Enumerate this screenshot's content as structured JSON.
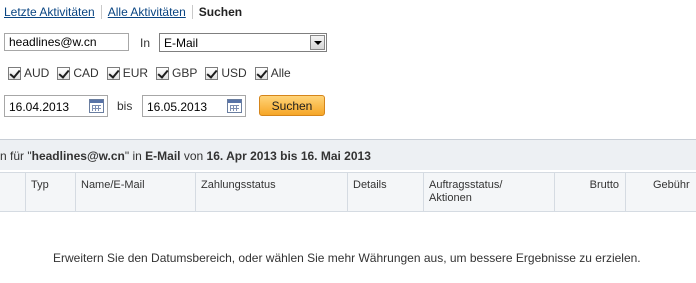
{
  "tabs": {
    "recent_activity": "Letzte Aktivitäten",
    "all_activity": "Alle Aktivitäten",
    "search": "Suchen"
  },
  "search": {
    "query_value": "headlines@w.cn",
    "in_label": "In",
    "field_selected": "E-Mail"
  },
  "currencies": [
    "AUD",
    "CAD",
    "EUR",
    "GBP",
    "USD",
    "Alle"
  ],
  "dates": {
    "from": "16.04.2013",
    "to_label": "bis",
    "to": "16.05.2013"
  },
  "submit_label": "Suchen",
  "results_header": {
    "prefix": "n für \"",
    "query": "headlines@w.cn",
    "mid1": "\" in ",
    "field": "E-Mail",
    "mid2": " von ",
    "from": "16. Apr 2013",
    "mid3": " bis ",
    "to": "16. Mai 2013"
  },
  "table": {
    "columns": {
      "type": "Typ",
      "name_email": "Name/E-Mail",
      "payment_status": "Zahlungsstatus",
      "details": "Details",
      "order_status_l1": "Auftragsstatus/",
      "order_status_l2": "Aktionen",
      "gross": "Brutto",
      "fee": "Gebühr"
    }
  },
  "empty_message": "Erweitern Sie den Datumsbereich, oder wählen Sie mehr Währungen aus, um bessere Ergebnisse zu erzielen.",
  "colors": {
    "link": "#084482",
    "accent_button": "#f6a627",
    "header_bg": "#edf0f3"
  }
}
